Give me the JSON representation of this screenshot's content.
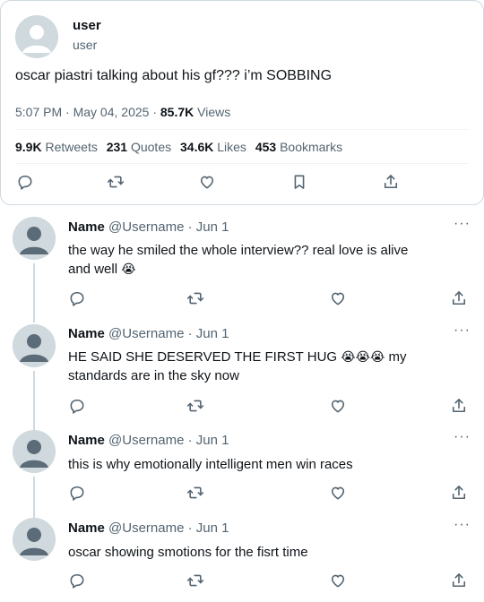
{
  "main_tweet": {
    "display_name": "user",
    "handle": "user",
    "text": "oscar piastri talking about his gf??? i’m SOBBING",
    "time": "5:07 PM",
    "date": "May 04, 2025",
    "views_count": "85.7K",
    "views_label": "Views",
    "stats": [
      {
        "count": "9.9K",
        "label": "Retweets"
      },
      {
        "count": "231",
        "label": "Quotes"
      },
      {
        "count": "34.6K",
        "label": "Likes"
      },
      {
        "count": "453",
        "label": "Bookmarks"
      }
    ],
    "actions": [
      "reply-icon",
      "retweet-icon",
      "like-icon",
      "bookmark-icon",
      "share-icon"
    ]
  },
  "replies": [
    {
      "name": "Name",
      "handle": "@Username",
      "date": "Jun 1",
      "text_line1": "the way he smiled the whole interview?? real love is alive",
      "text_line2": "and well",
      "emoji_line2": "😭",
      "more": "···"
    },
    {
      "name": "Name",
      "handle": "@Username",
      "date": "Jun 1",
      "text_line1": "HE SAID SHE DESERVED THE FIRST HUG",
      "emoji_line1": "😭😭😭",
      "text_line1b": "my",
      "text_line2": "standards are in the sky now",
      "more": "···"
    },
    {
      "name": "Name",
      "handle": "@Username",
      "date": "Jun 1",
      "text_line1": "this is why emotionally intelligent men win races",
      "more": "···"
    },
    {
      "name": "Name",
      "handle": "@Username",
      "date": "Jun 1",
      "text_line1": "oscar showing smotions for the fisrt time",
      "more": "···"
    }
  ],
  "colors": {
    "text": "#0f1419",
    "secondary": "#536471",
    "border": "#cfd9de",
    "avatar_bg": "#cfd9de",
    "avatar_fg": "#5b6b78"
  }
}
